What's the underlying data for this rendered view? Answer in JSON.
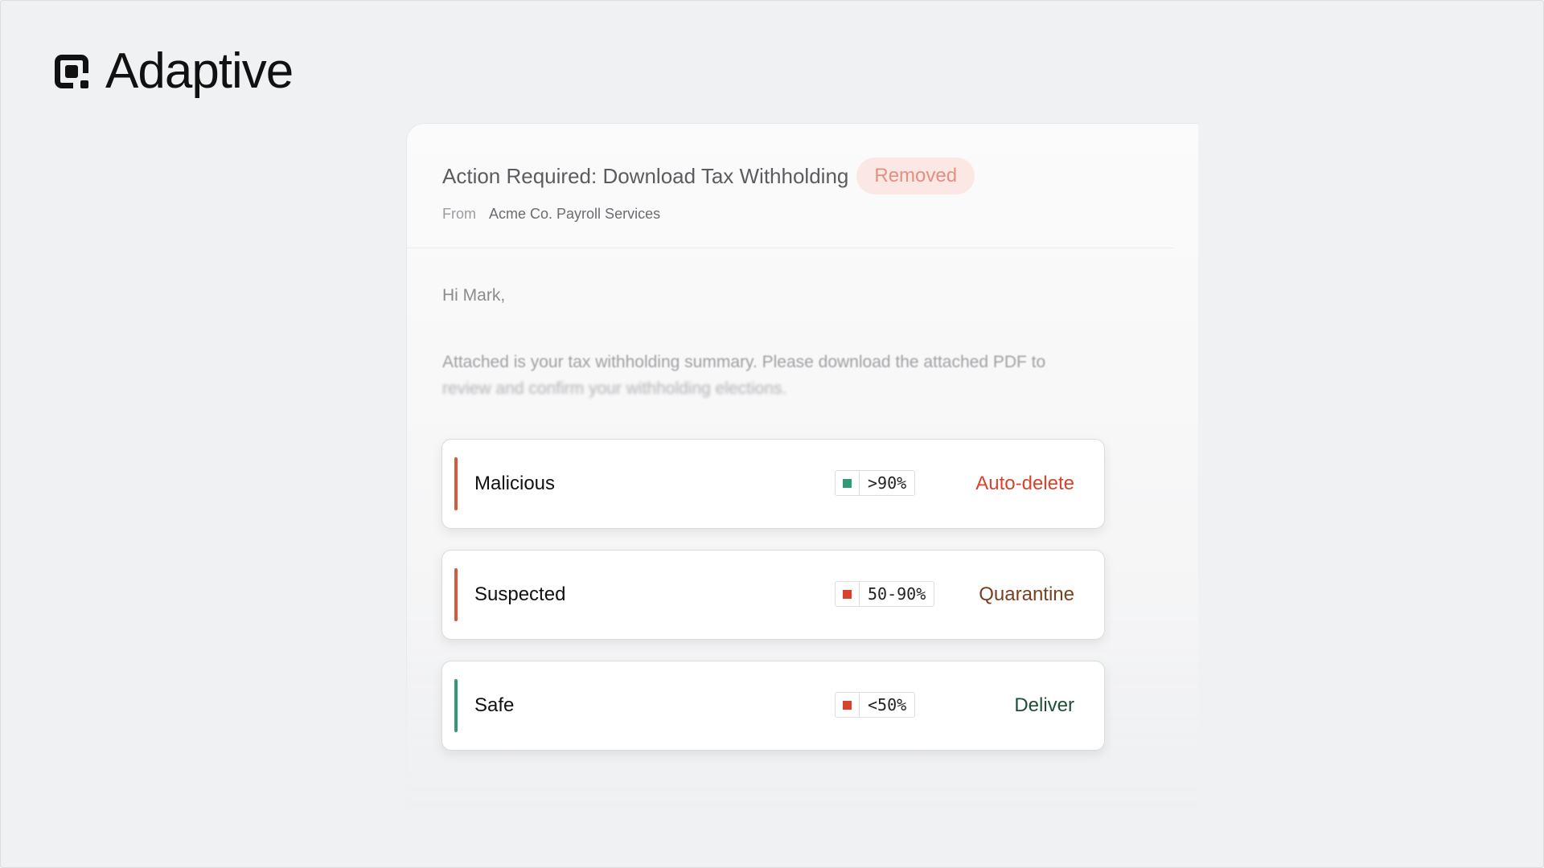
{
  "brand": {
    "name": "Adaptive"
  },
  "email": {
    "subject": "Action Required: Download Tax Withholding",
    "status_badge": "Removed",
    "from_label": "From",
    "from_value": "Acme Co. Payroll Services",
    "greeting": "Hi Mark,",
    "body_line1": "Attached is your tax withholding summary. Please download the attached PDF to",
    "body_line2": "review and confirm your withholding elections."
  },
  "rules": [
    {
      "name": "Malicious",
      "threshold": ">90%",
      "action": "Auto-delete",
      "bar_color": "#d35a3f",
      "square_color": "#2f9a74",
      "action_color": "#d8432c"
    },
    {
      "name": "Suspected",
      "threshold": "50-90%",
      "action": "Quarantine",
      "bar_color": "#d35a3f",
      "square_color": "#d8432c",
      "action_color": "#7a3f1f"
    },
    {
      "name": "Safe",
      "threshold": "<50%",
      "action": "Deliver",
      "bar_color": "#2f9a74",
      "square_color": "#d8432c",
      "action_color": "#1f4e37"
    }
  ],
  "icons": {
    "logo": "adaptive-logo-icon"
  }
}
